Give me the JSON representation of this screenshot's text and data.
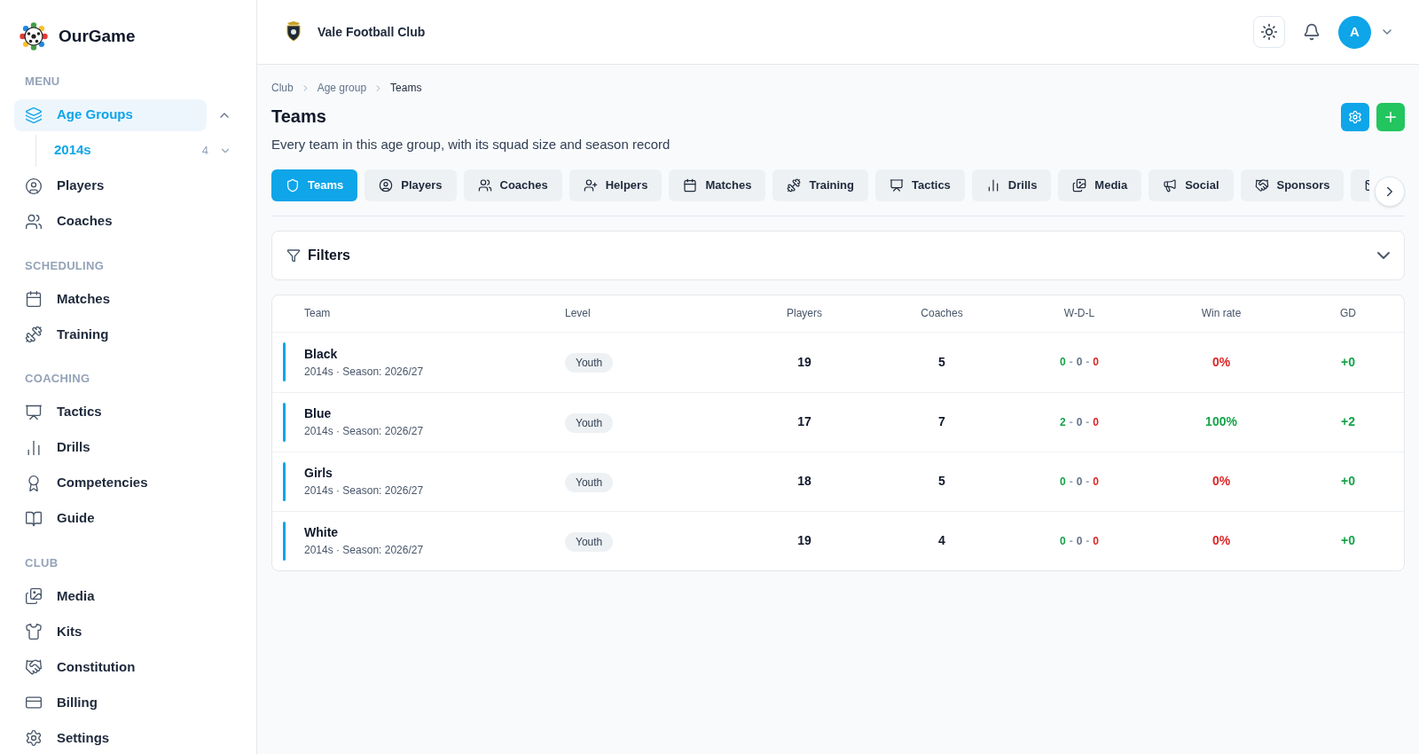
{
  "app": {
    "name": "OurGame"
  },
  "sidebar": {
    "sections": [
      {
        "title": "MENU",
        "items": [
          {
            "label": "Age Groups",
            "selected": true,
            "expanded": true,
            "children": [
              {
                "label": "2014s",
                "count": "4",
                "selected": true,
                "expanded": false
              }
            ]
          },
          {
            "label": "Players",
            "selected": false
          },
          {
            "label": "Coaches",
            "selected": false
          }
        ]
      },
      {
        "title": "SCHEDULING",
        "items": [
          {
            "label": "Matches",
            "selected": false
          },
          {
            "label": "Training",
            "selected": false
          }
        ]
      },
      {
        "title": "COACHING",
        "items": [
          {
            "label": "Tactics",
            "selected": false
          },
          {
            "label": "Drills",
            "selected": false
          },
          {
            "label": "Competencies",
            "selected": false
          },
          {
            "label": "Guide",
            "selected": false
          }
        ]
      },
      {
        "title": "CLUB",
        "items": [
          {
            "label": "Media",
            "selected": false
          },
          {
            "label": "Kits",
            "selected": false
          },
          {
            "label": "Constitution",
            "selected": false
          },
          {
            "label": "Billing",
            "selected": false
          },
          {
            "label": "Settings",
            "selected": false
          }
        ]
      }
    ]
  },
  "header": {
    "club": "Vale Football Club",
    "avatar": "A"
  },
  "breadcrumb": [
    "Club",
    "Age group",
    "Teams"
  ],
  "page": {
    "title": "Teams",
    "subtitle": "Every team in this age group, with its squad size and season record"
  },
  "tabs": [
    {
      "label": "Teams",
      "selected": true
    },
    {
      "label": "Players",
      "selected": false
    },
    {
      "label": "Coaches",
      "selected": false
    },
    {
      "label": "Helpers",
      "selected": false
    },
    {
      "label": "Matches",
      "selected": false
    },
    {
      "label": "Training",
      "selected": false
    },
    {
      "label": "Tactics",
      "selected": false
    },
    {
      "label": "Drills",
      "selected": false
    },
    {
      "label": "Media",
      "selected": false
    },
    {
      "label": "Social",
      "selected": false
    },
    {
      "label": "Sponsors",
      "selected": false
    },
    {
      "selected": false
    }
  ],
  "filters": {
    "title": "Filters",
    "expanded": false
  },
  "table": {
    "columns": [
      "Team",
      "Level",
      "Players",
      "Coaches",
      "W-D-L",
      "Win rate",
      "GD"
    ],
    "rows": [
      {
        "name": "Black",
        "meta": "2014s · Season: 2026/27",
        "level": "Youth",
        "players": "19",
        "coaches": "5",
        "record": [
          "0",
          "-",
          "0",
          "-",
          "0"
        ],
        "win_rate": "0%",
        "color": "#dc2626",
        "gd": "+0"
      },
      {
        "name": "Blue",
        "meta": "2014s · Season: 2026/27",
        "level": "Youth",
        "players": "17",
        "coaches": "7",
        "record": [
          "2",
          "-",
          "0",
          "-",
          "0"
        ],
        "win_rate": "100%",
        "color": "#16a34a",
        "gd": "+2"
      },
      {
        "name": "Girls",
        "meta": "2014s · Season: 2026/27",
        "level": "Youth",
        "players": "18",
        "coaches": "5",
        "record": [
          "0",
          "-",
          "0",
          "-",
          "0"
        ],
        "win_rate": "0%",
        "color": "#dc2626",
        "gd": "+0"
      },
      {
        "name": "White",
        "meta": "2014s · Season: 2026/27",
        "level": "Youth",
        "players": "19",
        "coaches": "4",
        "record": [
          "0",
          "-",
          "0",
          "-",
          "0"
        ],
        "win_rate": "0%",
        "color": "#dc2626",
        "gd": "+0"
      }
    ]
  }
}
